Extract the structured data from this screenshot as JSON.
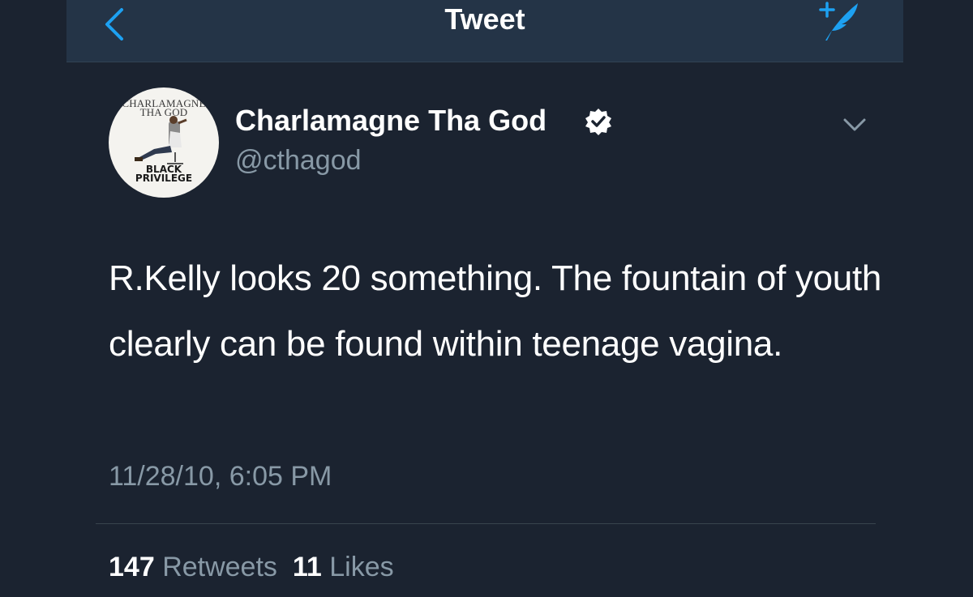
{
  "nav": {
    "title": "Tweet",
    "back_icon": "chevron-left-icon",
    "compose_icon": "compose-quill-icon"
  },
  "avatar": {
    "caption_top_line1": "CHARLAMAGNE",
    "caption_top_line2": "THA GOD",
    "caption_bottom_line1": "BLACK",
    "caption_bottom_line2": "PRIVILEGE"
  },
  "tweet": {
    "display_name": "Charlamagne Tha God",
    "handle": "@cthagod",
    "text": "R.Kelly looks 20 something. The fountain of youth clearly can be found within teenage vagina.",
    "timestamp": "11/28/10, 6:05 PM"
  },
  "stats": {
    "retweets_count": "147",
    "retweets_label": "Retweets",
    "likes_count": "11",
    "likes_label": "Likes"
  },
  "colors": {
    "background": "#1b2330",
    "nav_background": "#243447",
    "accent": "#1da1f2",
    "secondary_text": "#8899a6"
  }
}
